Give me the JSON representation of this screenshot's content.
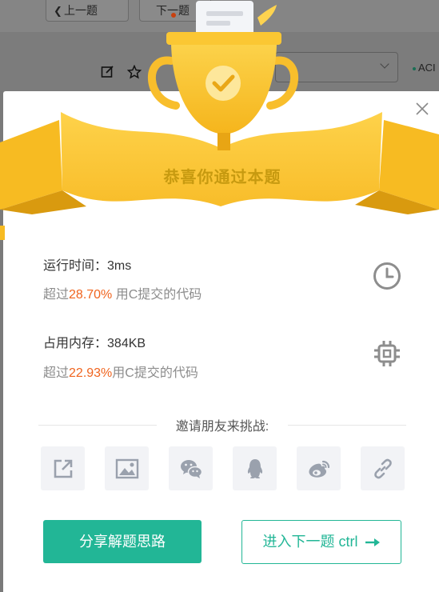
{
  "background": {
    "prev_label": "上一题",
    "next_label": "下一题",
    "status_label": "ACI"
  },
  "modal": {
    "title": "恭喜你通过本题",
    "runtime": {
      "label": "运行时间：",
      "value": "3ms",
      "beat_prefix": "超过",
      "beat_percent": "28.70%",
      "beat_suffix": " 用C提交的代码"
    },
    "memory": {
      "label": "占用内存：",
      "value": "384KB",
      "beat_prefix": "超过",
      "beat_percent": "22.93%",
      "beat_suffix": "用C提交的代码"
    },
    "invite_label": "邀请朋友来挑战:",
    "share_icons": [
      "external-share-icon",
      "image-icon",
      "wechat-icon",
      "qq-icon",
      "weibo-icon",
      "link-icon"
    ],
    "share_solution_label": "分享解题思路",
    "next_problem_label": "进入下一题 ctrl"
  },
  "colors": {
    "accent": "#22b696",
    "highlight": "#f0641e",
    "gold": "#f7c52c",
    "title_gold": "#c79a10"
  }
}
